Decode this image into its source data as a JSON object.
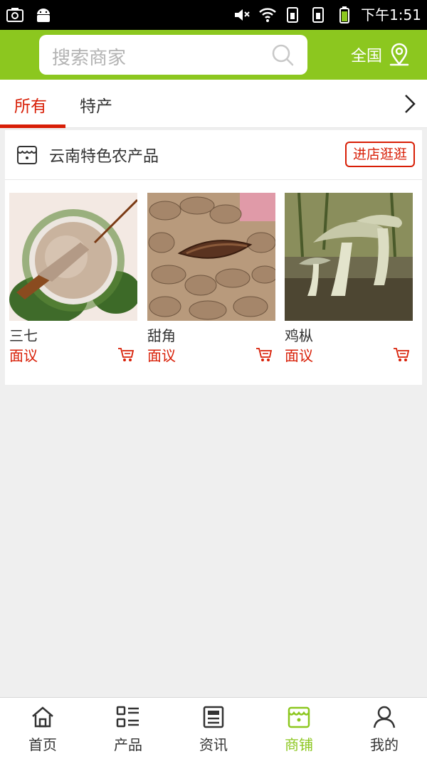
{
  "status_bar": {
    "time": "下午1:51",
    "left_icons": [
      "screenshot-icon",
      "android-icon"
    ],
    "right_icons": [
      "mute-icon",
      "wifi-icon",
      "sim1-icon",
      "sim2-icon",
      "battery-icon"
    ]
  },
  "header": {
    "search_placeholder": "搜索商家",
    "region_label": "全国",
    "background_color": "#8cc71f"
  },
  "tabs": {
    "items": [
      {
        "label": "所有",
        "active": true
      },
      {
        "label": "特产",
        "active": false
      }
    ],
    "accent_color": "#d81e06"
  },
  "shop": {
    "name": "云南特色农产品",
    "visit_label": "进店逛逛",
    "products": [
      {
        "name": "三七",
        "price": "面议"
      },
      {
        "name": "甜角",
        "price": "面议"
      },
      {
        "name": "鸡枞",
        "price": "面议"
      }
    ]
  },
  "bottom_nav": {
    "items": [
      {
        "label": "首页",
        "icon": "home-icon",
        "active": false
      },
      {
        "label": "产品",
        "icon": "product-list-icon",
        "active": false
      },
      {
        "label": "资讯",
        "icon": "news-icon",
        "active": false
      },
      {
        "label": "商铺",
        "icon": "store-icon",
        "active": true
      },
      {
        "label": "我的",
        "icon": "user-icon",
        "active": false
      }
    ],
    "active_color": "#8cc71f"
  }
}
